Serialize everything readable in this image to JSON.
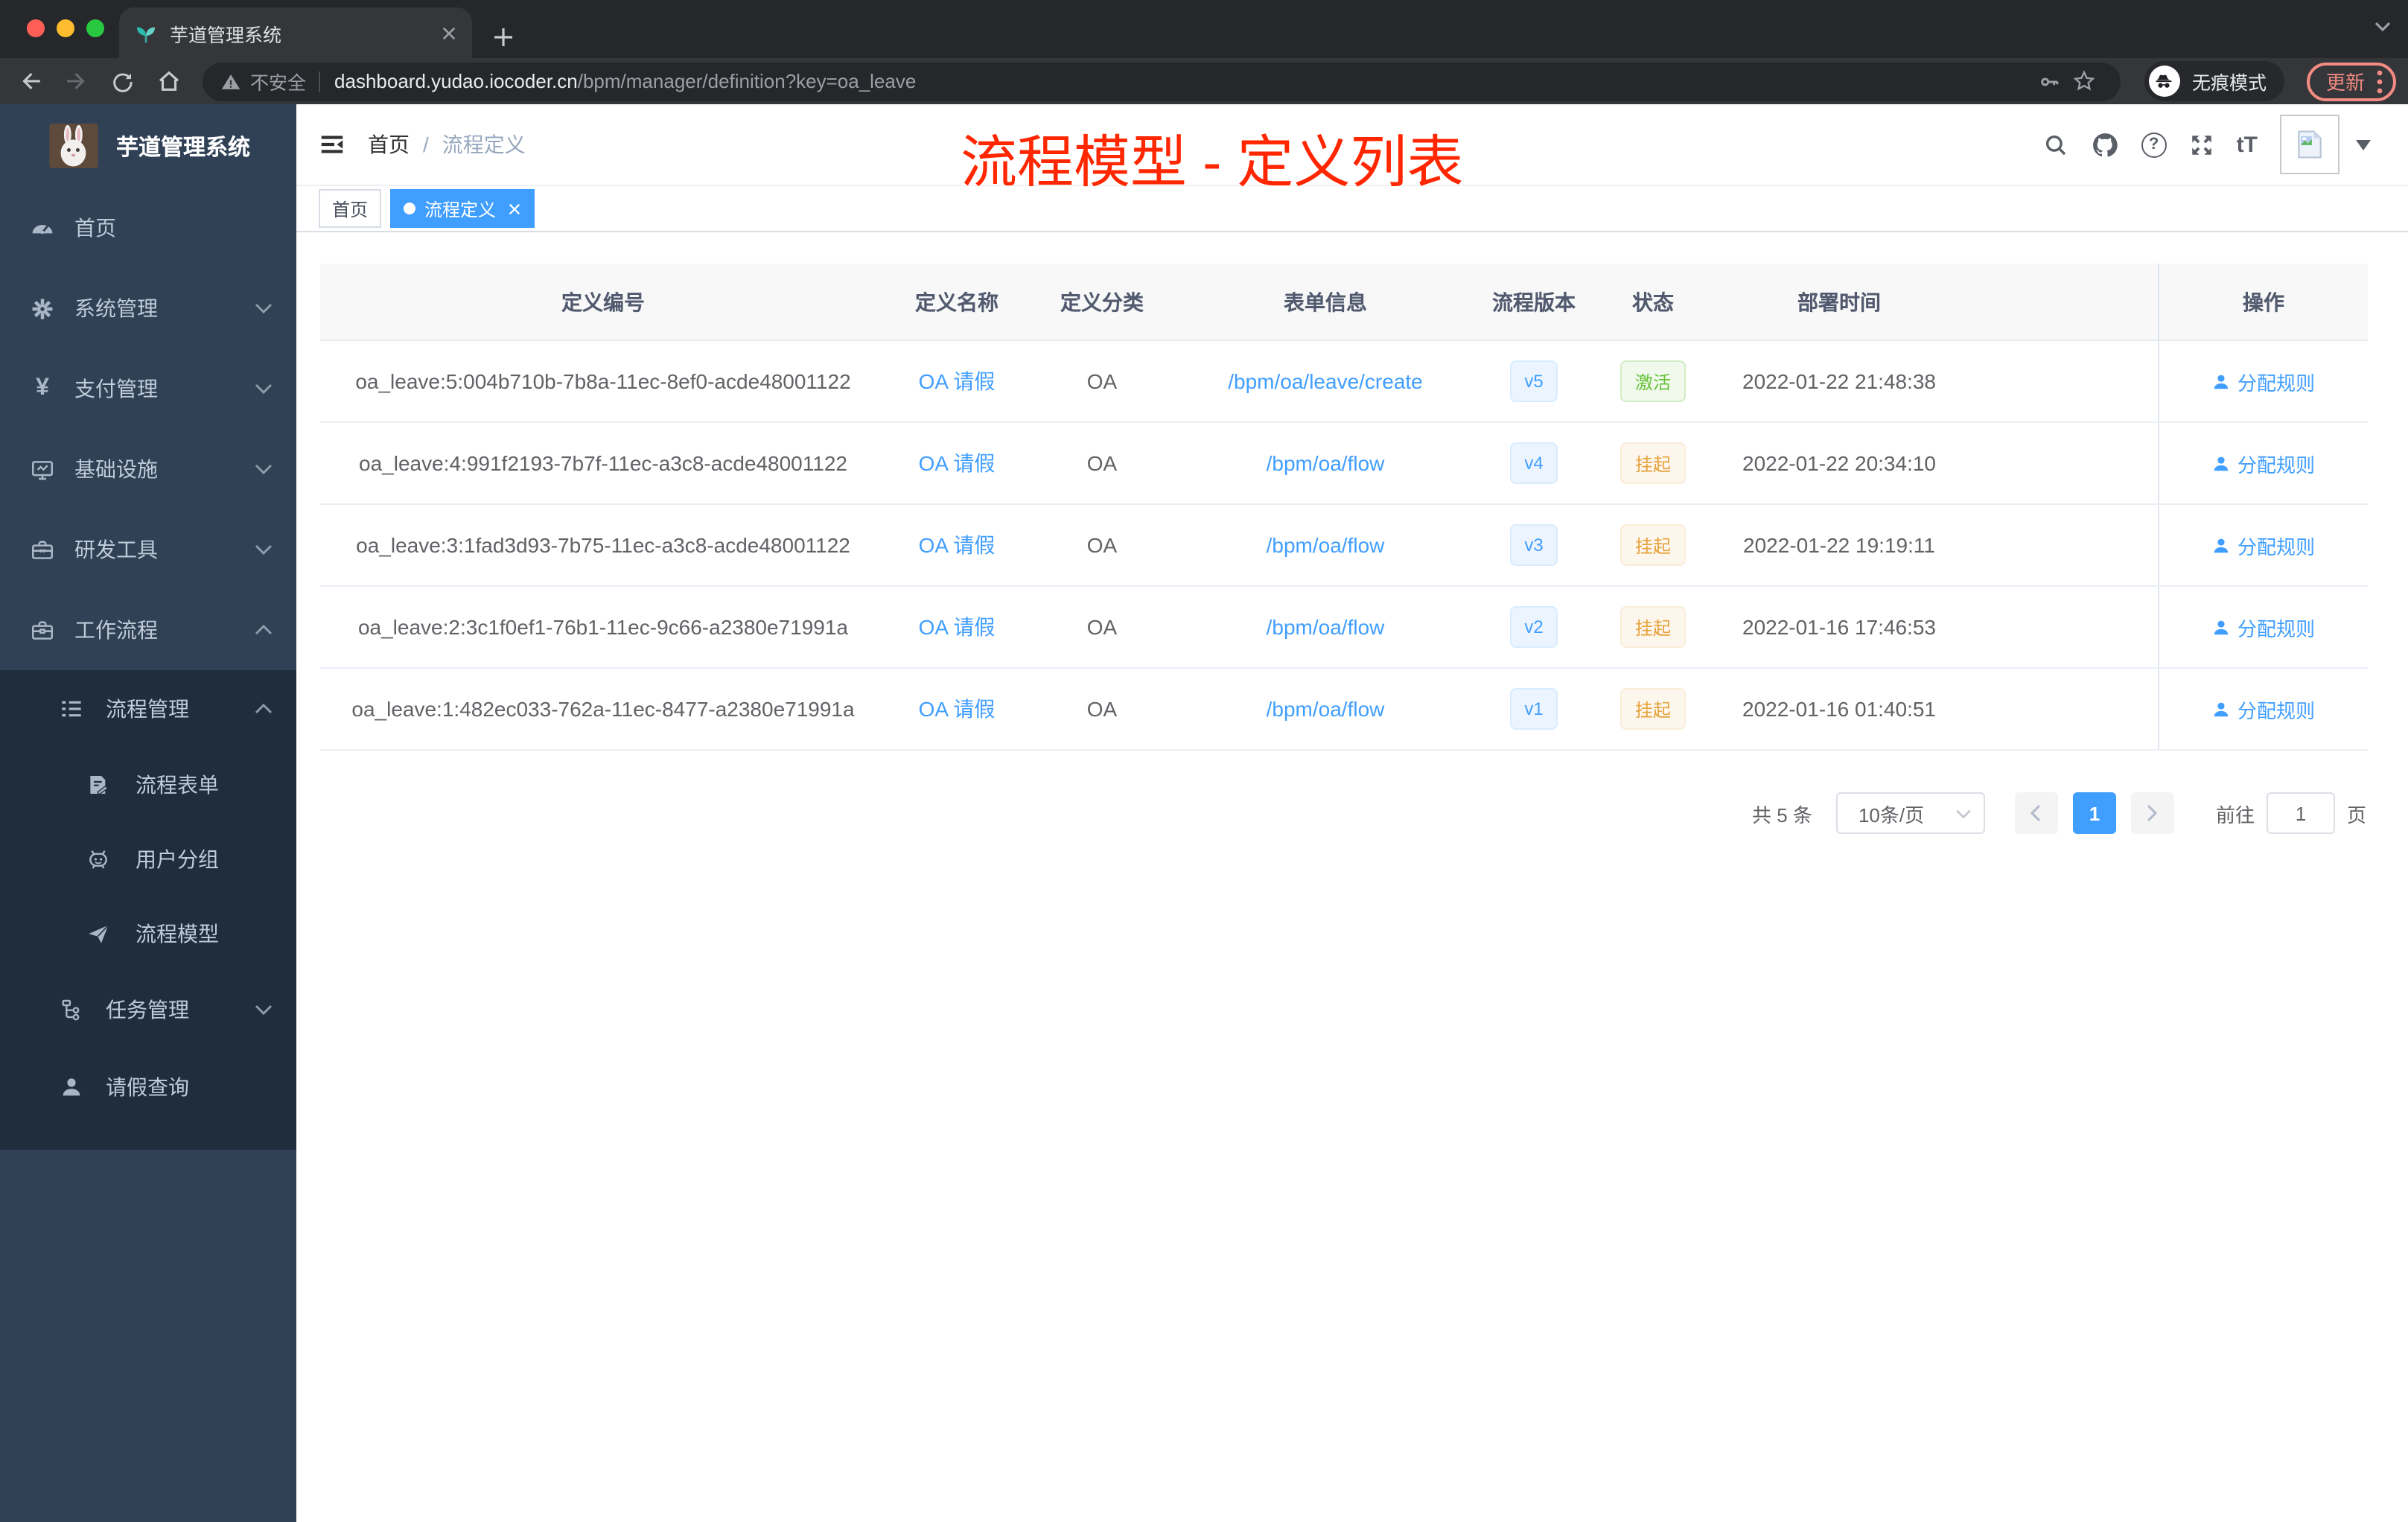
{
  "browser": {
    "tab_title": "芋道管理系统",
    "security_label": "不安全",
    "url_host": "dashboard.yudao.iocoder.cn",
    "url_path": "/bpm/manager/definition?key=oa_leave",
    "incognito_label": "无痕模式",
    "update_label": "更新"
  },
  "sidebar": {
    "title": "芋道管理系统",
    "items": [
      {
        "label": "首页"
      },
      {
        "label": "系统管理"
      },
      {
        "label": "支付管理"
      },
      {
        "label": "基础设施"
      },
      {
        "label": "研发工具"
      },
      {
        "label": "工作流程"
      },
      {
        "label": "流程管理"
      },
      {
        "label": "流程表单"
      },
      {
        "label": "用户分组"
      },
      {
        "label": "流程模型"
      },
      {
        "label": "任务管理"
      },
      {
        "label": "请假查询"
      }
    ],
    "yen_glyph": "¥"
  },
  "header": {
    "breadcrumb_home": "首页",
    "breadcrumb_separator": "/",
    "breadcrumb_current": "流程定义",
    "help_glyph": "?",
    "font_size_glyph": "tT"
  },
  "tags": {
    "home": "首页",
    "active": "流程定义"
  },
  "annotation": {
    "text": "流程模型 - 定义列表",
    "color": "#ff2600"
  },
  "table": {
    "headers": [
      "定义编号",
      "定义名称",
      "定义分类",
      "表单信息",
      "流程版本",
      "状态",
      "部署时间",
      "操作"
    ],
    "rows": [
      {
        "id": "oa_leave:5:004b710b-7b8a-11ec-8ef0-acde48001122",
        "name": "OA 请假",
        "category": "OA",
        "form": "/bpm/oa/leave/create",
        "version": "v5",
        "status": {
          "label": "激活",
          "type": "success"
        },
        "time": "2022-01-22 21:48:38",
        "action": "分配规则"
      },
      {
        "id": "oa_leave:4:991f2193-7b7f-11ec-a3c8-acde48001122",
        "name": "OA 请假",
        "category": "OA",
        "form": "/bpm/oa/flow",
        "version": "v4",
        "status": {
          "label": "挂起",
          "type": "warning"
        },
        "time": "2022-01-22 20:34:10",
        "action": "分配规则"
      },
      {
        "id": "oa_leave:3:1fad3d93-7b75-11ec-a3c8-acde48001122",
        "name": "OA 请假",
        "category": "OA",
        "form": "/bpm/oa/flow",
        "version": "v3",
        "status": {
          "label": "挂起",
          "type": "warning"
        },
        "time": "2022-01-22 19:19:11",
        "action": "分配规则"
      },
      {
        "id": "oa_leave:2:3c1f0ef1-76b1-11ec-9c66-a2380e71991a",
        "name": "OA 请假",
        "category": "OA",
        "form": "/bpm/oa/flow",
        "version": "v2",
        "status": {
          "label": "挂起",
          "type": "warning"
        },
        "time": "2022-01-16 17:46:53",
        "action": "分配规则"
      },
      {
        "id": "oa_leave:1:482ec033-762a-11ec-8477-a2380e71991a",
        "name": "OA 请假",
        "category": "OA",
        "form": "/bpm/oa/flow",
        "version": "v1",
        "status": {
          "label": "挂起",
          "type": "warning"
        },
        "time": "2022-01-16 01:40:51",
        "action": "分配规则"
      }
    ]
  },
  "pagination": {
    "total": "共 5 条",
    "page_size": "10条/页",
    "current_page": "1",
    "goto_label": "前往",
    "goto_value": "1",
    "unit_label": "页"
  },
  "colors": {
    "accent_blue": "#409eff",
    "status_green": "#67c23a",
    "status_orange": "#e6a23c",
    "annotation_red": "#ff2600",
    "sidebar_bg": "#304156",
    "submenu_bg": "#1f2d3d",
    "active_tag_bg": "#409eff"
  }
}
